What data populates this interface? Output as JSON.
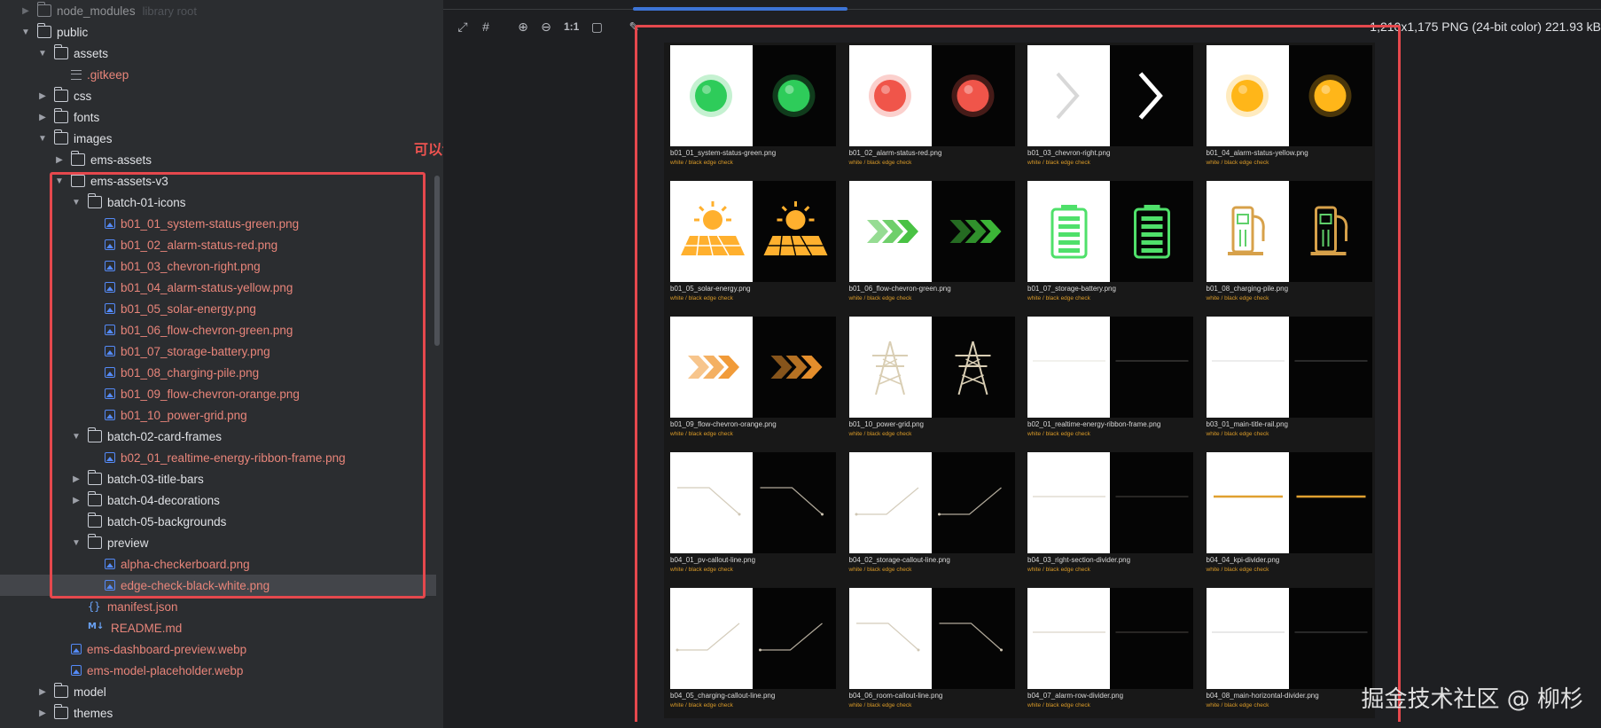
{
  "tree": {
    "partial_top": {
      "label": "node_modules",
      "hint": "library root"
    },
    "rows": [
      {
        "label": "public",
        "type": "folder",
        "state": "open",
        "depth": 0
      },
      {
        "label": "assets",
        "type": "folder",
        "state": "open",
        "depth": 1
      },
      {
        "label": ".gitkeep",
        "type": "text",
        "state": "none",
        "depth": 2
      },
      {
        "label": "css",
        "type": "folder",
        "state": "closed",
        "depth": 1
      },
      {
        "label": "fonts",
        "type": "folder",
        "state": "closed",
        "depth": 1
      },
      {
        "label": "images",
        "type": "folder",
        "state": "open",
        "depth": 1
      },
      {
        "label": "ems-assets",
        "type": "folder",
        "state": "closed",
        "depth": 2
      },
      {
        "label": "ems-assets-v3",
        "type": "folder",
        "state": "open",
        "depth": 2
      },
      {
        "label": "batch-01-icons",
        "type": "folder",
        "state": "open",
        "depth": 3
      },
      {
        "label": "b01_01_system-status-green.png",
        "type": "image",
        "state": "none",
        "depth": 4
      },
      {
        "label": "b01_02_alarm-status-red.png",
        "type": "image",
        "state": "none",
        "depth": 4
      },
      {
        "label": "b01_03_chevron-right.png",
        "type": "image",
        "state": "none",
        "depth": 4
      },
      {
        "label": "b01_04_alarm-status-yellow.png",
        "type": "image",
        "state": "none",
        "depth": 4
      },
      {
        "label": "b01_05_solar-energy.png",
        "type": "image",
        "state": "none",
        "depth": 4
      },
      {
        "label": "b01_06_flow-chevron-green.png",
        "type": "image",
        "state": "none",
        "depth": 4
      },
      {
        "label": "b01_07_storage-battery.png",
        "type": "image",
        "state": "none",
        "depth": 4
      },
      {
        "label": "b01_08_charging-pile.png",
        "type": "image",
        "state": "none",
        "depth": 4
      },
      {
        "label": "b01_09_flow-chevron-orange.png",
        "type": "image",
        "state": "none",
        "depth": 4
      },
      {
        "label": "b01_10_power-grid.png",
        "type": "image",
        "state": "none",
        "depth": 4
      },
      {
        "label": "batch-02-card-frames",
        "type": "folder",
        "state": "open",
        "depth": 3
      },
      {
        "label": "b02_01_realtime-energy-ribbon-frame.png",
        "type": "image",
        "state": "none",
        "depth": 4
      },
      {
        "label": "batch-03-title-bars",
        "type": "folder",
        "state": "closed",
        "depth": 3
      },
      {
        "label": "batch-04-decorations",
        "type": "folder",
        "state": "closed",
        "depth": 3
      },
      {
        "label": "batch-05-backgrounds",
        "type": "folder",
        "state": "none",
        "depth": 3
      },
      {
        "label": "preview",
        "type": "folder",
        "state": "open",
        "depth": 3
      },
      {
        "label": "alpha-checkerboard.png",
        "type": "image",
        "state": "none",
        "depth": 4
      },
      {
        "label": "edge-check-black-white.png",
        "type": "image",
        "state": "none",
        "depth": 4,
        "selected": true
      },
      {
        "label": "manifest.json",
        "type": "json",
        "state": "none",
        "depth": 3
      },
      {
        "label": "README.md",
        "type": "md",
        "state": "none",
        "depth": 3
      },
      {
        "label": "ems-dashboard-preview.webp",
        "type": "image",
        "state": "none",
        "depth": 2
      },
      {
        "label": "ems-model-placeholder.webp",
        "type": "image",
        "state": "none",
        "depth": 2
      },
      {
        "label": "model",
        "type": "folder",
        "state": "closed",
        "depth": 1
      },
      {
        "label": "themes",
        "type": "folder",
        "state": "closed",
        "depth": 1
      }
    ]
  },
  "annotation": "可以切割出真实的透明图片",
  "viewer": {
    "toolbar": {
      "icons": [
        "fit-screen-icon",
        "crop-grid-icon",
        "zoom-in-icon",
        "zoom-out-icon",
        "actual-size-icon",
        "background-toggle-icon",
        "color-picker-icon"
      ],
      "glyphs": [
        "⤢",
        "#",
        "⊕",
        "⊖",
        "1:1",
        "▢",
        "✎"
      ],
      "actual_size_label": "1:1"
    },
    "image_info": "1,210x1,175 PNG (24-bit color) 221.93 kB",
    "cards": [
      {
        "name": "b01_01_system-status-green.png",
        "sub": "white / black edge check",
        "kind": "dot",
        "color": "#2ecc5a"
      },
      {
        "name": "b01_02_alarm-status-red.png",
        "sub": "white / black edge check",
        "kind": "dot",
        "color": "#f0554a"
      },
      {
        "name": "b01_03_chevron-right.png",
        "sub": "white / black edge check",
        "kind": "chevron",
        "color": "#ffffff"
      },
      {
        "name": "b01_04_alarm-status-yellow.png",
        "sub": "white / black edge check",
        "kind": "dot",
        "color": "#ffb619"
      },
      {
        "name": "b01_05_solar-energy.png",
        "sub": "white / black edge check",
        "kind": "solar",
        "color": "#ffb02e"
      },
      {
        "name": "b01_06_flow-chevron-green.png",
        "sub": "white / black edge check",
        "kind": "flow",
        "color": "#3fbf3a"
      },
      {
        "name": "b01_07_storage-battery.png",
        "sub": "white / black edge check",
        "kind": "battery",
        "color": "#4fe06a"
      },
      {
        "name": "b01_08_charging-pile.png",
        "sub": "white / black edge check",
        "kind": "pile",
        "color": "#d7a14a"
      },
      {
        "name": "b01_09_flow-chevron-orange.png",
        "sub": "white / black edge check",
        "kind": "flow",
        "color": "#f0962e"
      },
      {
        "name": "b01_10_power-grid.png",
        "sub": "white / black edge check",
        "kind": "tower",
        "color": "#d9ceb4"
      },
      {
        "name": "b02_01_realtime-energy-ribbon-frame.png",
        "sub": "white / black edge check",
        "kind": "hline",
        "color": "#e4e0d8"
      },
      {
        "name": "b03_01_main-title-rail.png",
        "sub": "white / black edge check",
        "kind": "hline",
        "color": "#d8d8d8"
      },
      {
        "name": "b04_01_pv-callout-line.png",
        "sub": "white / black edge check",
        "kind": "callout-down",
        "color": "#cfc6b4"
      },
      {
        "name": "b04_02_storage-callout-line.png",
        "sub": "white / black edge check",
        "kind": "callout-up",
        "color": "#cfc6b4"
      },
      {
        "name": "b04_03_right-section-divider.png",
        "sub": "white / black edge check",
        "kind": "hline",
        "color": "#cfc6b4"
      },
      {
        "name": "b04_04_kpi-divider.png",
        "sub": "white / black edge check",
        "kind": "hline-bold",
        "color": "#e0a030"
      },
      {
        "name": "b04_05_charging-callout-line.png",
        "sub": "white / black edge check",
        "kind": "callout-up",
        "color": "#cfc6b4"
      },
      {
        "name": "b04_06_room-callout-line.png",
        "sub": "white / black edge check",
        "kind": "callout-down",
        "color": "#cfc6b4"
      },
      {
        "name": "b04_07_alarm-row-divider.png",
        "sub": "white / black edge check",
        "kind": "hline",
        "color": "#cfc6b4"
      },
      {
        "name": "b04_08_main-horizontal-divider.png",
        "sub": "white / black edge check",
        "kind": "hline",
        "color": "#cfcfcf"
      }
    ]
  },
  "watermark": "掘金技术社区 @ 柳杉",
  "colors": {
    "accent": "#3d74d6",
    "highlight_box": "#e5484d",
    "file_text": "#e8857a",
    "preview_sub": "#d99a28"
  }
}
